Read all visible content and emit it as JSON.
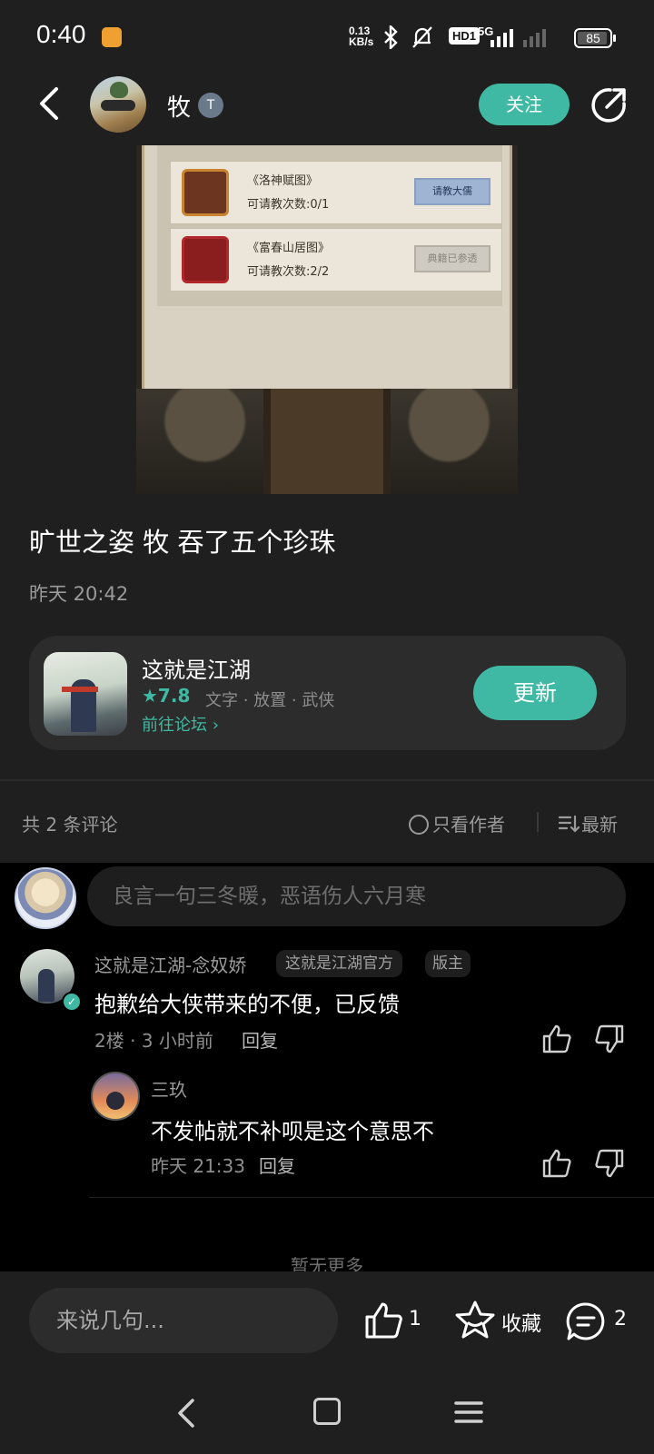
{
  "status_bar": {
    "time": "0:40",
    "network_speed": "0.13\nKB/s",
    "hd_badge": "HD1",
    "signal_label": "5G",
    "battery": "85"
  },
  "header": {
    "author_name": "牧",
    "follow_label": "关注"
  },
  "post_image": {
    "rows": [
      {
        "title": "《洛神赋图》",
        "count": "可请教次数:0/1",
        "button": "请教大儒"
      },
      {
        "title": "《富春山居图》",
        "count": "可请教次数:2/2",
        "button": "典籍已参透"
      }
    ]
  },
  "post": {
    "title": "旷世之姿 牧 吞了五个珍珠",
    "time": "昨天 20:42"
  },
  "game_card": {
    "name": "这就是江湖",
    "rating": "★7.8",
    "tags": "文字 · 放置 · 武侠",
    "forum_link": "前往论坛 ›",
    "update_label": "更新"
  },
  "comments_header": {
    "count": "共 2 条评论",
    "only_author": "只看作者",
    "sort": "最新"
  },
  "comment_input": {
    "placeholder": "良言一句三冬暖，恶语伤人六月寒"
  },
  "comment": {
    "author": "这就是江湖-念奴娇",
    "tag_official": "这就是江湖官方",
    "tag_moderator": "版主",
    "text": "抱歉给大侠带来的不便，已反馈",
    "meta": "2楼 · 3 小时前",
    "reply_label": "回复"
  },
  "reply": {
    "author": "三玖",
    "text": "不发帖就不补呗是这个意思不",
    "meta": "昨天 21:33",
    "reply_label": "回复"
  },
  "no_more": "暂无更多",
  "bottom_bar": {
    "input_placeholder": "来说几句...",
    "like_count": "1",
    "favorite_label": "收藏",
    "comment_count": "2"
  },
  "colors": {
    "accent": "#3fb9a3",
    "background": "#1f1f1f",
    "comments_background": "#000000"
  }
}
